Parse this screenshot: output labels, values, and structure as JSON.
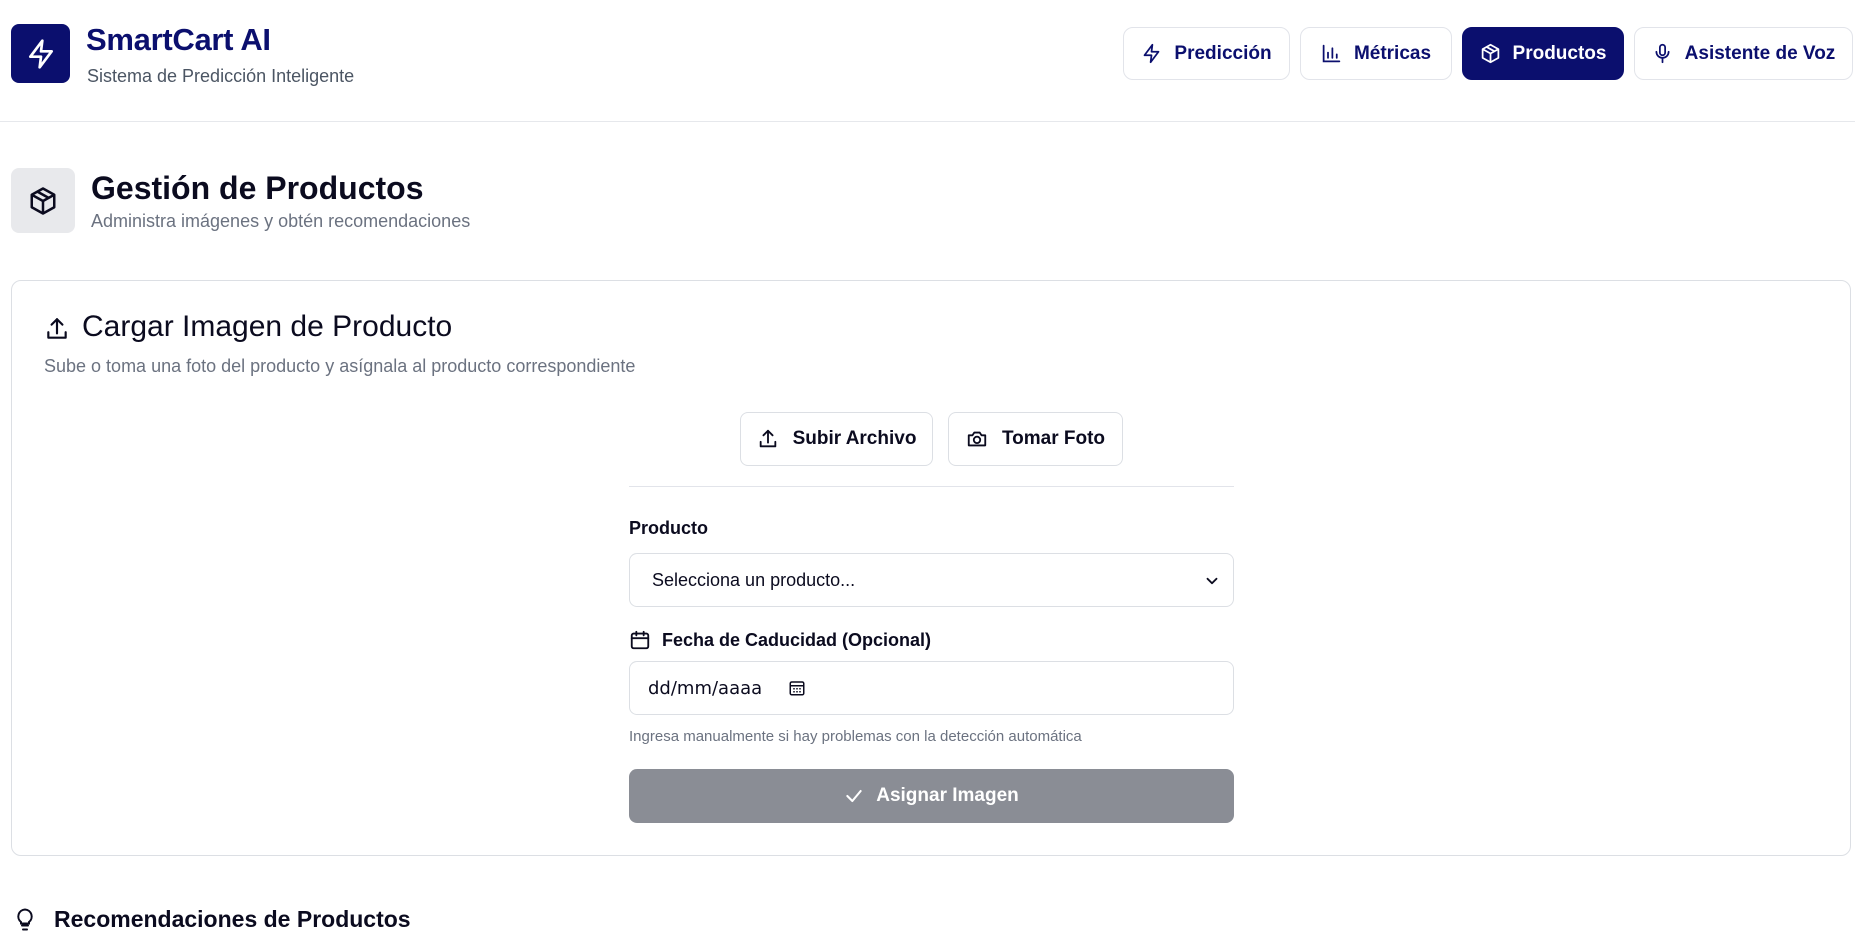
{
  "header": {
    "title": "SmartCart AI",
    "subtitle": "Sistema de Predicción Inteligente",
    "logo_icon": "lightning-icon"
  },
  "nav": {
    "items": [
      {
        "label": "Predicción",
        "icon": "lightning-icon",
        "active": false
      },
      {
        "label": "Métricas",
        "icon": "bar-chart-icon",
        "active": false
      },
      {
        "label": "Productos",
        "icon": "package-icon",
        "active": true
      },
      {
        "label": "Asistente de Voz",
        "icon": "microphone-icon",
        "active": false
      }
    ]
  },
  "page": {
    "title": "Gestión de Productos",
    "subtitle": "Administra imágenes y obtén recomendaciones",
    "icon": "package-icon"
  },
  "upload_card": {
    "title": "Cargar Imagen de Producto",
    "description": "Sube o toma una foto del producto y asígnala al producto correspondiente",
    "upload_button": "Subir Archivo",
    "camera_button": "Tomar Foto",
    "product_label": "Producto",
    "product_select_value": "Selecciona un producto...",
    "expiry_label": "Fecha de Caducidad (Opcional)",
    "date_placeholder": "dd/mm/aaaa",
    "hint": "Ingresa manualmente si hay problemas con la detección automática",
    "assign_button": "Asignar Imagen"
  },
  "recommendations": {
    "title": "Recomendaciones de Productos",
    "icon": "lightbulb-icon"
  },
  "colors": {
    "brand": "#0b0f6e",
    "disabled_button": "#8a8d95",
    "muted_text": "#6b7280",
    "border": "#dcdfe4"
  }
}
